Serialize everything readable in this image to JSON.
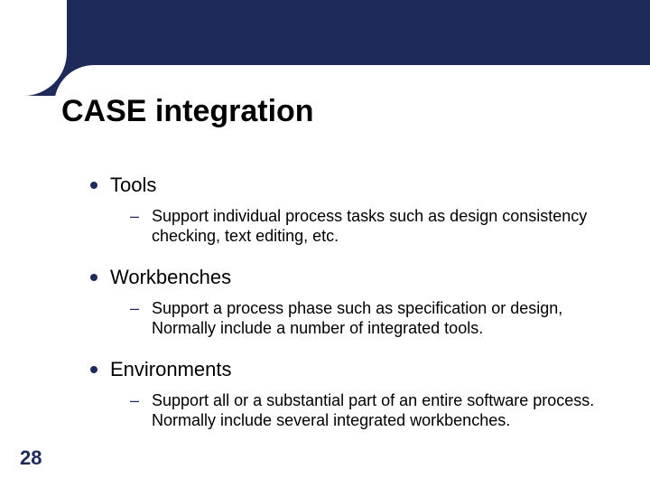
{
  "slide": {
    "title": "CASE integration",
    "page_number": "28",
    "bullets": [
      {
        "label": "Tools",
        "sub": "Support individual process tasks such as design consistency checking, text editing, etc."
      },
      {
        "label": "Workbenches",
        "sub": "Support a process phase such as specification or design, Normally include a number of integrated tools."
      },
      {
        "label": "Environments",
        "sub": "Support all or a substantial part of an entire software process. Normally include several integrated workbenches."
      }
    ]
  }
}
